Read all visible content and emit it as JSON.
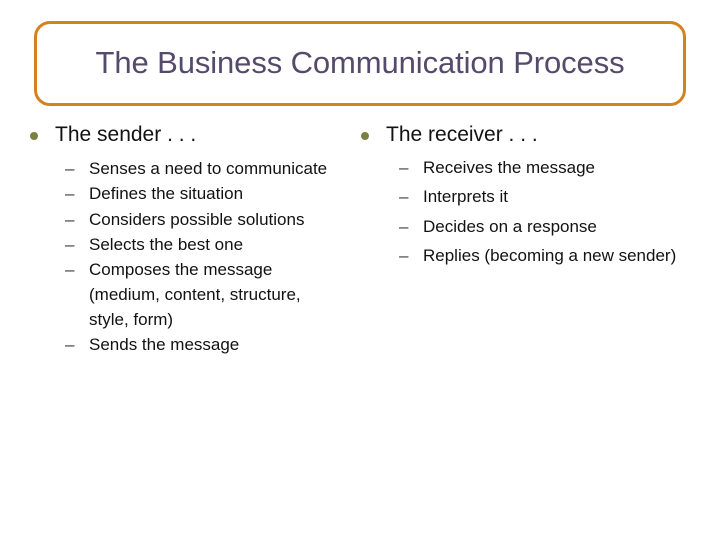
{
  "slide": {
    "title": "The Business Communication Process",
    "colors": {
      "title_border": "#D4821E",
      "title_text": "#554A6B",
      "bullet_dot": "#7B8040",
      "dash_marker": "#3A3A46",
      "body_text": "#121212",
      "background": "#ffffff"
    }
  },
  "columns": [
    {
      "heading": "The sender . . .",
      "bullet_icon": "filled-circle-bullet",
      "items": [
        {
          "marker": "–",
          "text": "Senses a need to communicate"
        },
        {
          "marker": "–",
          "text": "Defines the situation"
        },
        {
          "marker": "–",
          "text": "Considers possible solutions"
        },
        {
          "marker": "–",
          "text": "Selects the best one"
        },
        {
          "marker": "–",
          "text": "Composes the message (medium, content, structure, style, form)"
        },
        {
          "marker": "–",
          "text": "Sends the message"
        }
      ]
    },
    {
      "heading": "The receiver . . .",
      "bullet_icon": "filled-circle-bullet",
      "items": [
        {
          "marker": "–",
          "text": "Receives the message"
        },
        {
          "marker": "–",
          "text": "Interprets it"
        },
        {
          "marker": "–",
          "text": "Decides on a response"
        },
        {
          "marker": "–",
          "text": "Replies (becoming a new sender)"
        }
      ]
    }
  ]
}
